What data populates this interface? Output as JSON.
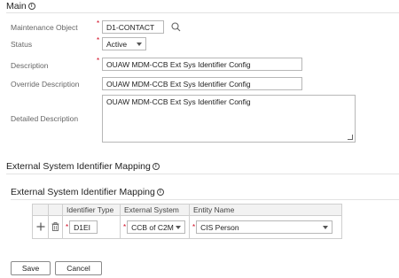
{
  "main": {
    "title": "Main",
    "info_glyph": "i",
    "fields": {
      "maintenance_object": {
        "label": "Maintenance Object",
        "value": "D1-CONTACT"
      },
      "status": {
        "label": "Status",
        "value": "Active"
      },
      "description": {
        "label": "Description",
        "value": "OUAW MDM-CCB Ext Sys Identifier Config"
      },
      "override_description": {
        "label": "Override Description",
        "value": "OUAW MDM-CCB Ext Sys Identifier Config"
      },
      "detailed_description": {
        "label": "Detailed Description",
        "value": "OUAW MDM-CCB Ext Sys Identifier Config"
      }
    },
    "required_marker": "*"
  },
  "mapping_section": {
    "title": "External System Identifier Mapping",
    "subsection_title": "External System Identifier Mapping",
    "columns": [
      "Identifier Type",
      "External System",
      "Entity Name"
    ],
    "rows": [
      {
        "identifier_type": "D1EI",
        "external_system": "CCB of C2M",
        "entity_name": "CIS Person"
      }
    ]
  },
  "actions": {
    "save_label": "Save",
    "cancel_label": "Cancel"
  },
  "icons": {
    "search": "search-icon",
    "add": "plus-icon",
    "delete": "trash-icon",
    "info": "info-icon"
  }
}
